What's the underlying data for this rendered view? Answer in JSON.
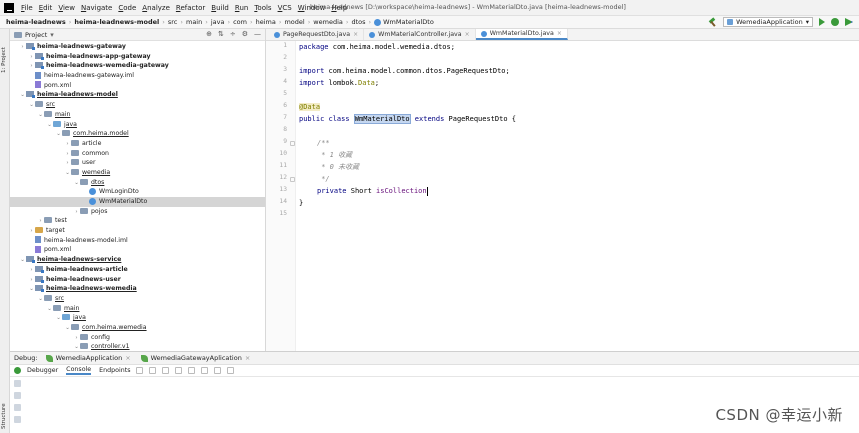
{
  "menubar": {
    "items": [
      {
        "label": "File",
        "u": "F",
        "rest": "ile"
      },
      {
        "label": "Edit",
        "u": "E",
        "rest": "dit"
      },
      {
        "label": "View",
        "u": "V",
        "rest": "iew"
      },
      {
        "label": "Navigate",
        "u": "N",
        "rest": "avigate"
      },
      {
        "label": "Code",
        "u": "C",
        "rest": "ode"
      },
      {
        "label": "Analyze",
        "u": "A",
        "rest": "nalyze"
      },
      {
        "label": "Refactor",
        "u": "R",
        "rest": "efactor"
      },
      {
        "label": "Build",
        "u": "B",
        "rest": "uild"
      },
      {
        "label": "Run",
        "u": "R",
        "rest": "un"
      },
      {
        "label": "Tools",
        "u": "T",
        "rest": "ools"
      },
      {
        "label": "VCS",
        "u": "V",
        "rest": "CS"
      },
      {
        "label": "Window",
        "u": "W",
        "rest": "indow"
      },
      {
        "label": "Help",
        "u": "H",
        "rest": "elp"
      }
    ],
    "window_title": "heima-leadnews [D:\\workspace\\heima-leadnews] - WmMaterialDto.java [heima-leadnews-model]"
  },
  "navbar": {
    "crumbs": [
      "heima-leadnews",
      "heima-leadnews-model",
      "src",
      "main",
      "java",
      "com",
      "heima",
      "model",
      "wemedia",
      "dtos",
      "WmMaterialDto"
    ],
    "run_config": "WemediaApplication"
  },
  "left_strip": {
    "project_label": "1: Project",
    "structure_label": "Structure"
  },
  "project_panel": {
    "title": "Project",
    "tree": [
      {
        "indent": 1,
        "arrow": "›",
        "icon": "module",
        "label": "heima-leadnews-gateway",
        "bold": true
      },
      {
        "indent": 2,
        "arrow": "›",
        "icon": "module",
        "label": "heima-leadnews-app-gateway",
        "bold": true
      },
      {
        "indent": 2,
        "arrow": "›",
        "icon": "module",
        "label": "heima-leadnews-wemedia-gateway",
        "bold": true
      },
      {
        "indent": 2,
        "arrow": "",
        "icon": "xml",
        "label": "heima-leadnews-gateway.iml"
      },
      {
        "indent": 2,
        "arrow": "",
        "icon": "file",
        "label": "pom.xml"
      },
      {
        "indent": 1,
        "arrow": "⌄",
        "icon": "module",
        "label": "heima-leadnews-model",
        "bold": true,
        "ul": true
      },
      {
        "indent": 2,
        "arrow": "⌄",
        "icon": "folder",
        "label": "src",
        "ul": true
      },
      {
        "indent": 3,
        "arrow": "⌄",
        "icon": "folder",
        "label": "main",
        "ul": true
      },
      {
        "indent": 4,
        "arrow": "⌄",
        "icon": "src",
        "label": "java",
        "ul": true
      },
      {
        "indent": 5,
        "arrow": "⌄",
        "icon": "folder",
        "label": "com.heima.model",
        "ul": true
      },
      {
        "indent": 6,
        "arrow": "›",
        "icon": "folder",
        "label": "article"
      },
      {
        "indent": 6,
        "arrow": "›",
        "icon": "folder",
        "label": "common"
      },
      {
        "indent": 6,
        "arrow": "›",
        "icon": "folder",
        "label": "user"
      },
      {
        "indent": 6,
        "arrow": "⌄",
        "icon": "folder",
        "label": "wemedia",
        "ul": true
      },
      {
        "indent": 7,
        "arrow": "⌄",
        "icon": "folder",
        "label": "dtos",
        "ul": true
      },
      {
        "indent": 8,
        "arrow": "",
        "icon": "class",
        "label": "WmLoginDto"
      },
      {
        "indent": 8,
        "arrow": "",
        "icon": "class",
        "label": "WmMaterialDto",
        "selected": true
      },
      {
        "indent": 7,
        "arrow": "›",
        "icon": "folder",
        "label": "pojos"
      },
      {
        "indent": 3,
        "arrow": "›",
        "icon": "folder",
        "label": "test"
      },
      {
        "indent": 2,
        "arrow": "›",
        "icon": "yellow",
        "label": "target"
      },
      {
        "indent": 2,
        "arrow": "",
        "icon": "xml",
        "label": "heima-leadnews-model.iml"
      },
      {
        "indent": 2,
        "arrow": "",
        "icon": "file",
        "label": "pom.xml"
      },
      {
        "indent": 1,
        "arrow": "⌄",
        "icon": "module",
        "label": "heima-leadnews-service",
        "bold": true,
        "ul": true
      },
      {
        "indent": 2,
        "arrow": "›",
        "icon": "module",
        "label": "heima-leadnews-article",
        "bold": true
      },
      {
        "indent": 2,
        "arrow": "›",
        "icon": "module",
        "label": "heima-leadnews-user",
        "bold": true
      },
      {
        "indent": 2,
        "arrow": "⌄",
        "icon": "module",
        "label": "heima-leadnews-wemedia",
        "bold": true,
        "ul": true
      },
      {
        "indent": 3,
        "arrow": "⌄",
        "icon": "folder",
        "label": "src",
        "ul": true
      },
      {
        "indent": 4,
        "arrow": "⌄",
        "icon": "folder",
        "label": "main",
        "ul": true
      },
      {
        "indent": 5,
        "arrow": "⌄",
        "icon": "src",
        "label": "java",
        "ul": true
      },
      {
        "indent": 6,
        "arrow": "⌄",
        "icon": "folder",
        "label": "com.heima.wemedia",
        "ul": true
      },
      {
        "indent": 7,
        "arrow": "›",
        "icon": "folder",
        "label": "config"
      },
      {
        "indent": 7,
        "arrow": "⌄",
        "icon": "folder",
        "label": "controller.v1",
        "ul": true
      }
    ]
  },
  "editor": {
    "tabs": [
      {
        "label": "PageRequestDto.java",
        "active": false
      },
      {
        "label": "WmMaterialController.java",
        "active": false
      },
      {
        "label": "WmMaterialDto.java",
        "active": true
      }
    ],
    "line_numbers": [
      "1",
      "2",
      "3",
      "4",
      "5",
      "6",
      "7",
      "8",
      "9",
      "10",
      "11",
      "12",
      "13",
      "14",
      "15"
    ],
    "lines": {
      "l1_kw": "package",
      "l1_rest": " com.heima.model.wemedia.dtos;",
      "l3_kw": "import",
      "l3_rest": " com.heima.model.common.dtos.PageRequestDto;",
      "l4_kw": "import",
      "l4_rest": " lombok.",
      "l4_data": "Data",
      "l4_end": ";",
      "l6_ann": "@Data",
      "l7_kw1": "public class",
      "l7_cls": "WmMaterialDto",
      "l7_kw2": " extends",
      "l7_rest": " PageRequestDto {",
      "l9": "/**",
      "l10": " * 1 收藏",
      "l11": " * 0 未收藏",
      "l12": " */",
      "l13_kw": "private",
      "l13_rest": " Short ",
      "l13_field": "isCollection",
      "l14": "}"
    }
  },
  "debug": {
    "label": "Debug:",
    "run_tabs": [
      "WemediaApplication",
      "WemediaGatewayAplication"
    ],
    "tool_tabs": [
      "Debugger",
      "Console",
      "Endpoints"
    ]
  },
  "watermark": "CSDN @幸运小新"
}
